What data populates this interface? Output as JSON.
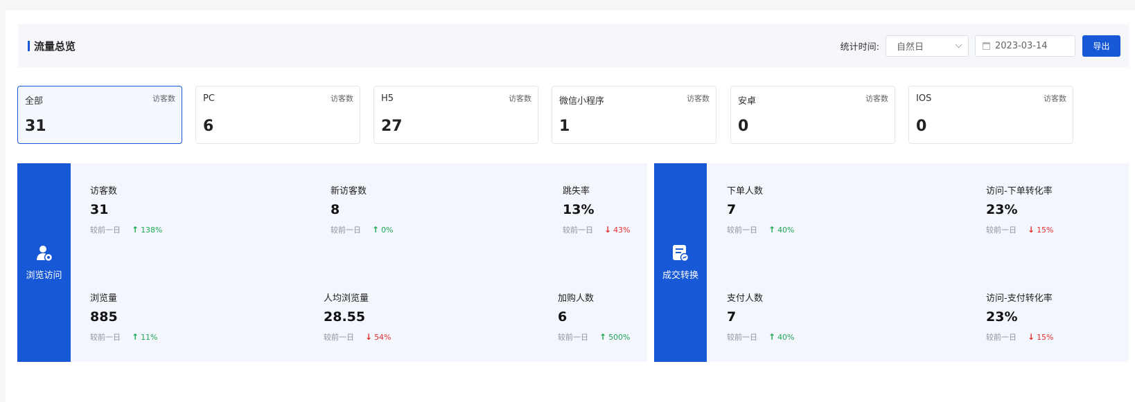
{
  "header": {
    "title": "流量总览",
    "stat_label": "统计时间:",
    "period_select": "自然日",
    "date_value": "2023-03-14",
    "export_label": "导出"
  },
  "cards": [
    {
      "name": "全部",
      "sub": "访客数",
      "value": "31",
      "active": true
    },
    {
      "name": "PC",
      "sub": "访客数",
      "value": "6",
      "active": false
    },
    {
      "name": "H5",
      "sub": "访客数",
      "value": "27",
      "active": false
    },
    {
      "name": "微信小程序",
      "sub": "访客数",
      "value": "1",
      "active": false
    },
    {
      "name": "安卓",
      "sub": "访客数",
      "value": "0",
      "active": false
    },
    {
      "name": "IOS",
      "sub": "访客数",
      "value": "0",
      "active": false
    }
  ],
  "browse": {
    "label": "浏览访问",
    "icon": "user-view-icon",
    "metrics": [
      {
        "label": "访客数",
        "value": "31",
        "cmp_label": "较前一日",
        "change": "138%",
        "dir": "up"
      },
      {
        "label": "新访客数",
        "value": "8",
        "cmp_label": "较前一日",
        "change": "0%",
        "dir": "up"
      },
      {
        "label": "跳失率",
        "value": "13%",
        "cmp_label": "较前一日",
        "change": "43%",
        "dir": "down"
      },
      {
        "label": "浏览量",
        "value": "885",
        "cmp_label": "较前一日",
        "change": "11%",
        "dir": "up"
      },
      {
        "label": "人均浏览量",
        "value": "28.55",
        "cmp_label": "较前一日",
        "change": "54%",
        "dir": "down"
      },
      {
        "label": "加购人数",
        "value": "6",
        "cmp_label": "较前一日",
        "change": "500%",
        "dir": "up"
      }
    ]
  },
  "conversion": {
    "label": "成交转换",
    "icon": "order-chart-icon",
    "metrics": [
      {
        "label": "下单人数",
        "value": "7",
        "cmp_label": "较前一日",
        "change": "40%",
        "dir": "up"
      },
      {
        "label": "访问-下单转化率",
        "value": "23%",
        "cmp_label": "较前一日",
        "change": "15%",
        "dir": "down"
      },
      {
        "label": "支付人数",
        "value": "7",
        "cmp_label": "较前一日",
        "change": "40%",
        "dir": "up"
      },
      {
        "label": "访问-支付转化率",
        "value": "23%",
        "cmp_label": "较前一日",
        "change": "15%",
        "dir": "down"
      }
    ]
  },
  "colors": {
    "primary": "#1658d6",
    "up": "#1fa855",
    "down": "#e52f2f",
    "panel_bg": "#f3f6fc"
  }
}
